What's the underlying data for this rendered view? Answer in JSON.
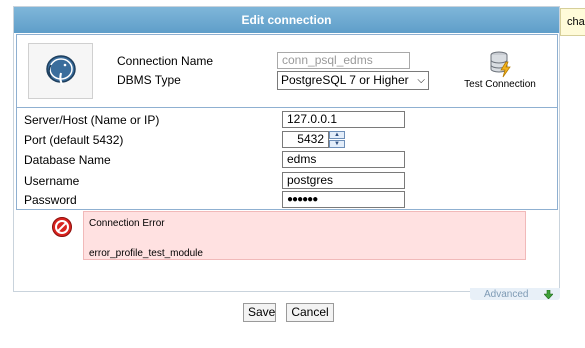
{
  "dialog": {
    "title": "Edit connection"
  },
  "side_tab": {
    "label": "cha"
  },
  "connection": {
    "name_label": "Connection Name",
    "name_value": "conn_psql_edms",
    "dbms_label": "DBMS Type",
    "dbms_value": "PostgreSQL 7 or Higher",
    "dbms_chevron": "⌵"
  },
  "test_connection": {
    "label": "Test Connection"
  },
  "fields": {
    "server_label": "Server/Host (Name or IP)",
    "server_value": "127.0.0.1",
    "port_label": "Port (default 5432)",
    "port_value": "5432",
    "database_label": "Database Name",
    "database_value": "edms",
    "username_label": "Username",
    "username_value": "postgres",
    "password_label": "Password",
    "password_value": "●●●●●●"
  },
  "error": {
    "title": "Connection Error",
    "message": "error_profile_test_module"
  },
  "advanced": {
    "label": "Advanced"
  },
  "buttons": {
    "save": "Save",
    "cancel": "Cancel"
  },
  "colors": {
    "title_bar": "#6aa7d2",
    "error_bg": "#ffe1e1",
    "border_blue": "#8fb0d1"
  }
}
